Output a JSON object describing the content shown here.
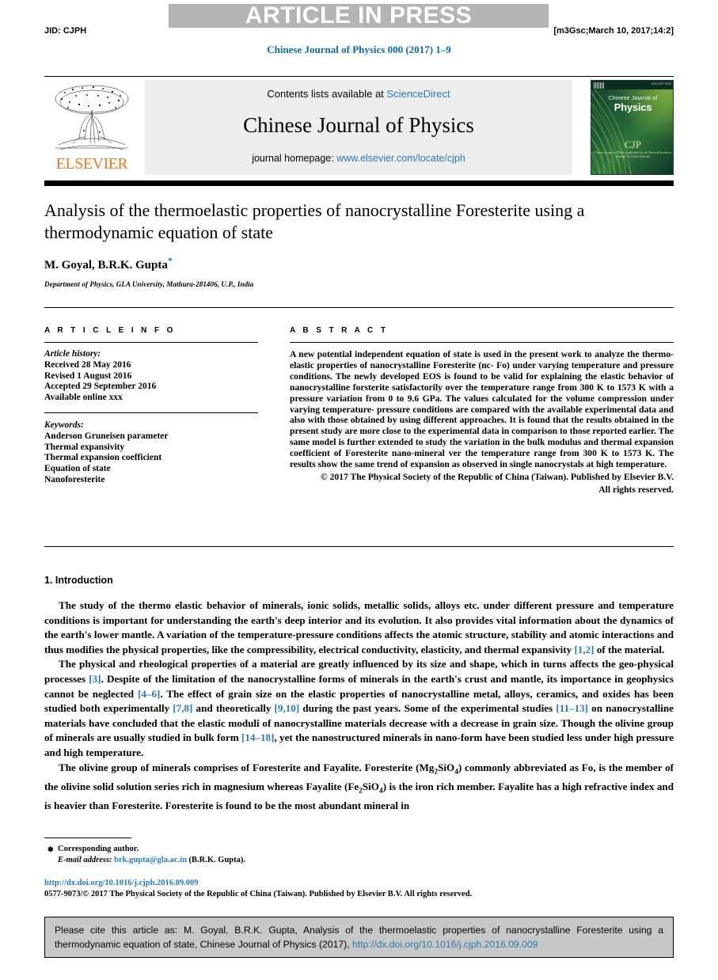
{
  "banner": {
    "text": "ARTICLE IN PRESS"
  },
  "running_head": {
    "jid": "JID: CJPH",
    "stamp": "[m3Gsc;March 10, 2017;14:2]"
  },
  "journal_ref": "Chinese Journal of Physics 000 (2017) 1–9",
  "masthead": {
    "contents_prefix": "Contents lists available at ",
    "contents_link": "ScienceDirect",
    "journal_name": "Chinese Journal of Physics",
    "homepage_label": "journal homepage: ",
    "homepage_url": "www.elsevier.com/locate/cjph",
    "publisher_wordmark": "ELSEVIER",
    "cover": {
      "line1": "Chinese Journal of",
      "line2": "Physics",
      "logo": "CJP",
      "logo_sub": "Chinese Journal of Physics published by the Physical Society of Republic of China (Taiwan)",
      "issn": "ISSN 0577-9073"
    }
  },
  "article": {
    "title": "Analysis of the thermoelastic properties of nanocrystalline Foresterite using a thermodynamic equation of state",
    "authors": "M. Goyal, B.R.K. Gupta",
    "corresponding_marker": "*",
    "affiliation": "Department of Physics, GLA University, Mathura-281406, U.P., India"
  },
  "info": {
    "heading": "A R T I C L E    I N F O",
    "history_label": "Article history:",
    "history": [
      "Received 28 May 2016",
      "Revised 1 August 2016",
      "Accepted 29 September 2016",
      "Available online xxx"
    ],
    "keywords_label": "Keywords:",
    "keywords": [
      "Anderson Gruneisen parameter",
      "Thermal expansivity",
      "Thermal expansion coefficient",
      "Equation of state",
      "Nanoforesterite"
    ]
  },
  "abstract": {
    "heading": "A B S T R A C T",
    "text": "A new potential independent equation of state is used in the present work to analyze the thermo-elastic properties of nanocrystalline Foresterite (nc- Fo) under varying temperature and pressure conditions. The newly developed EOS is found to be valid for explaining the elastic behavior of nanocrystalline forsterite satisfactorily over the temperature range from 300 K to 1573 K with a pressure variation from 0 to 9.6 GPa. The values calculated for the volume compression under varying temperature- pressure conditions are compared with the available experimental data and also with those obtained by using different approaches. It is found that the results obtained in the present study are more close to the experimental data in comparison to those reported earlier. The same model is further extended to study the variation in the bulk modulus and thermal expansion coefficient of Foresterite nano-mineral ver the temperature range from 300 K to 1573 K. The results show the same trend of expansion as observed in single nanocrystals at high temperature.",
    "copyright_line1": "© 2017 The Physical Society of the Republic of China (Taiwan). Published by Elsevier B.V.",
    "copyright_line2": "All rights reserved."
  },
  "introduction": {
    "heading": "1. Introduction",
    "paragraph1_a": "The study of the thermo elastic behavior of minerals, ionic solids, metallic solids, alloys etc. under different pressure and temperature conditions is important for understanding the earth's deep interior and its evolution. It also provides vital information about the dynamics of the earth's lower mantle. A variation of the temperature-pressure conditions affects the atomic structure, stability and atomic interactions and thus modifies the physical properties, like the compressibility, electrical conductivity, elasticity, and thermal expansivity ",
    "paragraph1_ref": "[1,2]",
    "paragraph1_b": " of the material.",
    "paragraph2_a": "The physical and rheological properties of a material are greatly influenced by its size and shape, which in turns affects the geo-physical processes ",
    "paragraph2_ref1": "[3]",
    "paragraph2_b": ". Despite of the limitation of the nanocrystalline forms of minerals in the earth's crust and mantle, its importance in geophysics cannot be neglected ",
    "paragraph2_ref2": "[4–6]",
    "paragraph2_c": ". The effect of grain size on the elastic properties of nanocrystalline metal, alloys, ceramics, and oxides has been studied both experimentally ",
    "paragraph2_ref3": "[7,8]",
    "paragraph2_d": " and theoretically ",
    "paragraph2_ref4": "[9,10]",
    "paragraph2_e": " during the past years. Some of the experimental studies ",
    "paragraph2_ref5": "[11–13]",
    "paragraph2_f": " on nanocrystalline materials have concluded that the elastic moduli of nanocrystalline materials decrease with a decrease in grain size. Though the olivine group of minerals are usually studied in bulk form ",
    "paragraph2_ref6": "[14–18]",
    "paragraph2_g": ", yet the nanostructured minerals in nano-form have been studied less under high pressure and high temperature.",
    "paragraph3_a": "The olivine group of minerals comprises of Foresterite and Fayalite. Foresterite (Mg",
    "paragraph3_sub1": "2",
    "paragraph3_b": "SiO",
    "paragraph3_sub2": "4",
    "paragraph3_c": ") commonly abbreviated as Fo, is the member of the olivine solid solution series rich in magnesium whereas Fayalite (Fe",
    "paragraph3_sub3": "2",
    "paragraph3_d": "SiO",
    "paragraph3_sub4": "4",
    "paragraph3_e": ") is the iron rich member. Fayalite has a high refractive index and is heavier than Foresterite. Foresterite is found to be the most abundant mineral in"
  },
  "footer": {
    "corresponding_author": "Corresponding author.",
    "email_label": "E-mail address:",
    "email": "brk.gupta@gla.ac.in",
    "email_owner": "(B.R.K. Gupta).",
    "doi_url": "http://dx.doi.org/10.1016/j.cjph.2016.09.009",
    "issn_copyright": "0577-9073/© 2017 The Physical Society of the Republic of China (Taiwan). Published by Elsevier B.V. All rights reserved."
  },
  "cite_box": {
    "text": "Please cite this article as: M. Goyal, B.R.K. Gupta, Analysis of the thermoelastic properties of nanocrystalline Foresterite using a thermodynamic equation of state, Chinese Journal of Physics (2017), ",
    "link": "http://dx.doi.org/10.1016/j.cjph.2016.09.009"
  },
  "colors": {
    "link": "#2a7ab0",
    "banner_bg": "#b4b4b4",
    "elsevier_orange": "#e87722",
    "cite_bg": "#c8c8c8"
  }
}
